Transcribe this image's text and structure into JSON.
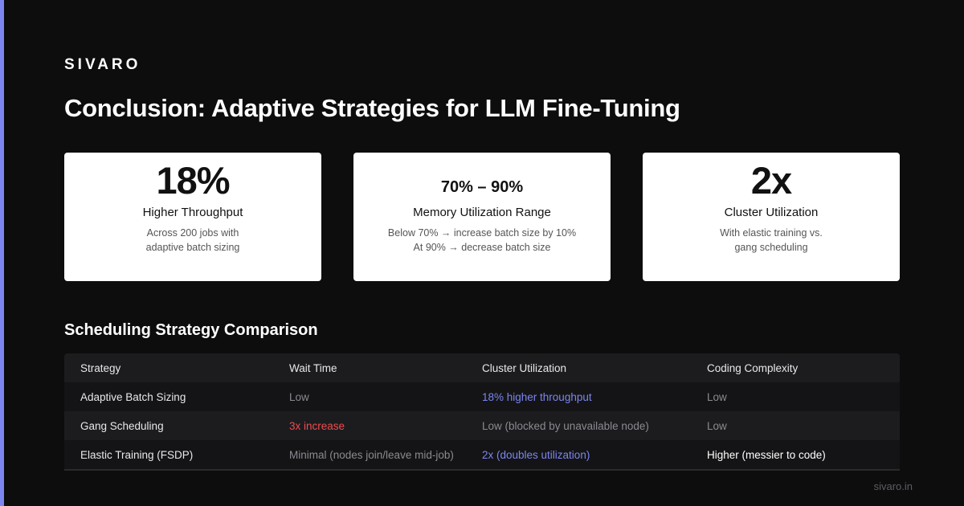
{
  "brand": "SIVARO",
  "title": "Conclusion: Adaptive Strategies for LLM Fine-Tuning",
  "accent_color": "#7b86f0",
  "cards": [
    {
      "metric": "18%",
      "label": "Higher Throughput",
      "desc_lines": [
        "Across 200 jobs with",
        "adaptive batch sizing"
      ]
    },
    {
      "metric": "70% – 90%",
      "label": "Memory Utilization Range",
      "desc_lines": [
        "Below 70% → increase batch size by 10%",
        "At 90% → decrease batch size"
      ]
    },
    {
      "metric": "2x",
      "label": "Cluster Utilization",
      "desc_lines": [
        "With elastic training vs.",
        "gang scheduling"
      ]
    }
  ],
  "table": {
    "title": "Scheduling Strategy Comparison",
    "headers": [
      "Strategy",
      "Wait Time",
      "Cluster Utilization",
      "Coding Complexity"
    ],
    "rows": [
      [
        "Adaptive Batch Sizing",
        "Low",
        "18% higher throughput",
        "Low"
      ],
      [
        "Gang Scheduling",
        "3x increase",
        "Low (blocked by unavailable node)",
        "Low"
      ],
      [
        "Elastic Training (FSDP)",
        "Minimal (nodes join/leave mid-job)",
        "2x (doubles utilization)",
        "Higher (messier to code)"
      ]
    ]
  },
  "footer": "sivaro.in"
}
